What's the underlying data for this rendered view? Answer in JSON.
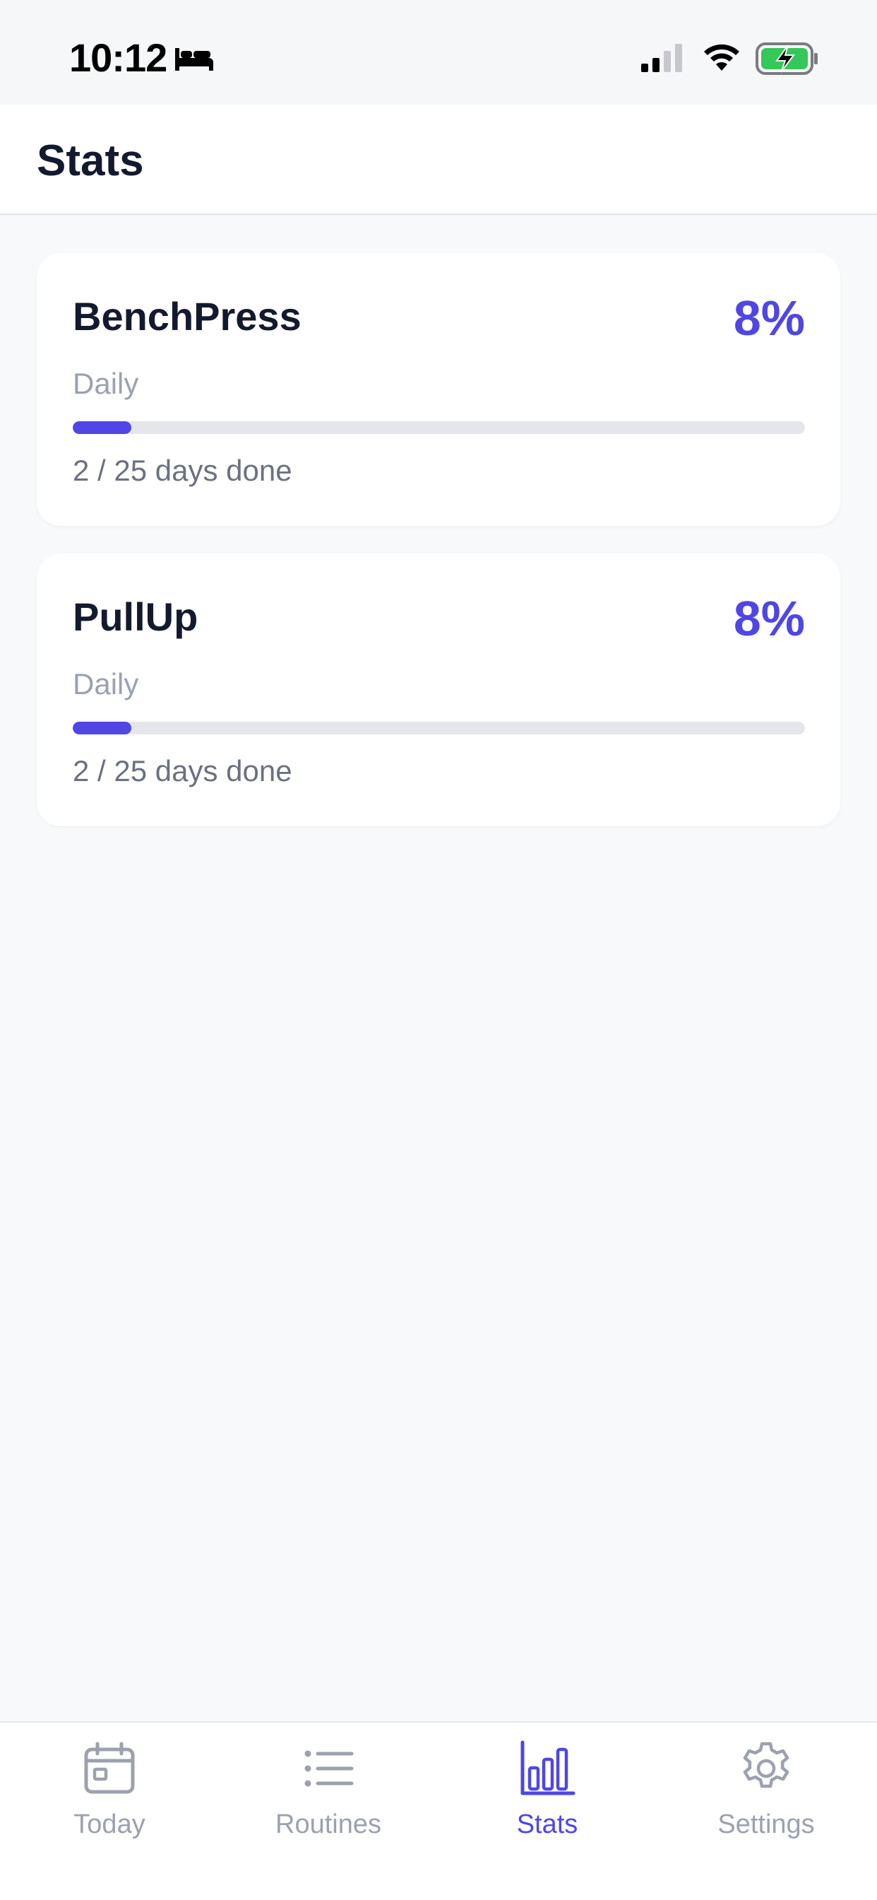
{
  "status_bar": {
    "time": "10:12"
  },
  "header": {
    "title": "Stats"
  },
  "stats": [
    {
      "name": "BenchPress",
      "percent_label": "8%",
      "frequency": "Daily",
      "progress_fraction": 0.08,
      "progress_text": "2 / 25 days done"
    },
    {
      "name": "PullUp",
      "percent_label": "8%",
      "frequency": "Daily",
      "progress_fraction": 0.08,
      "progress_text": "2 / 25 days done"
    }
  ],
  "tab_bar": {
    "tabs": [
      {
        "label": "Today",
        "icon": "calendar-icon",
        "active": false
      },
      {
        "label": "Routines",
        "icon": "list-icon",
        "active": false
      },
      {
        "label": "Stats",
        "icon": "bar-chart-icon",
        "active": true
      },
      {
        "label": "Settings",
        "icon": "gear-icon",
        "active": false
      }
    ]
  },
  "colors": {
    "accent": "#4f46e5",
    "inactive": "#9ca1ae",
    "background": "#f8f9fb",
    "track": "#e5e6eb",
    "battery": "#34c759"
  }
}
